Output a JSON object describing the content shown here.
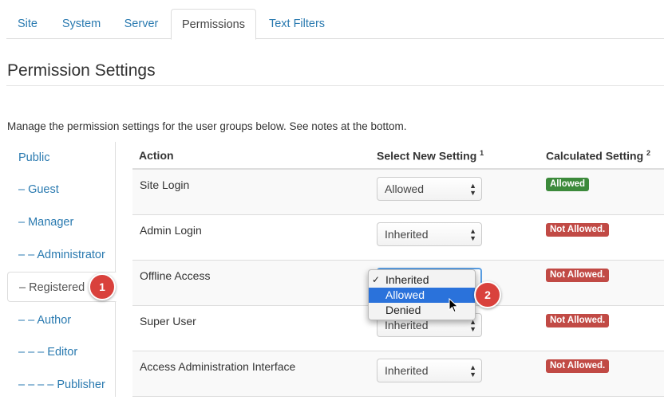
{
  "tabs": [
    {
      "label": "Site"
    },
    {
      "label": "System"
    },
    {
      "label": "Server"
    },
    {
      "label": "Permissions"
    },
    {
      "label": "Text Filters"
    }
  ],
  "page_title": "Permission Settings",
  "description": "Manage the permission settings for the user groups below. See notes at the bottom.",
  "groups": [
    {
      "label": "Public"
    },
    {
      "label": "– Guest"
    },
    {
      "label": "– Manager"
    },
    {
      "label": "– – Administrator"
    },
    {
      "label": "– Registered"
    },
    {
      "label": "– – Author"
    },
    {
      "label": "– – – Editor"
    },
    {
      "label": "– – – – Publisher"
    }
  ],
  "callouts": {
    "one": "1",
    "two": "2"
  },
  "table": {
    "headers": {
      "action": "Action",
      "select": "Select New Setting",
      "select_sup": "1",
      "calculated": "Calculated Setting",
      "calculated_sup": "2"
    },
    "rows": [
      {
        "action": "Site Login",
        "setting": "Allowed",
        "calculated": "Allowed"
      },
      {
        "action": "Admin Login",
        "setting": "Inherited",
        "calculated": "Not Allowed."
      },
      {
        "action": "Offline Access",
        "setting": "",
        "calculated": "Not Allowed."
      },
      {
        "action": "Super User",
        "setting": "Inherited",
        "calculated": "Not Allowed."
      },
      {
        "action": "Access Administration Interface",
        "setting": "Inherited",
        "calculated": "Not Allowed."
      }
    ]
  },
  "dropdown": {
    "options": [
      {
        "label": "Inherited",
        "checked": true
      },
      {
        "label": "Allowed",
        "highlighted": true
      },
      {
        "label": "Denied"
      }
    ]
  },
  "colors": {
    "link": "#2a7ab0",
    "allowed_badge": "#3c8a3b",
    "not_allowed_badge": "#c14a45",
    "callout": "#d9413c",
    "highlight": "#2a72db"
  },
  "icons": {
    "select_arrows": "updown-arrows-icon",
    "checkmark": "check-icon",
    "cursor": "mouse-pointer-icon"
  }
}
